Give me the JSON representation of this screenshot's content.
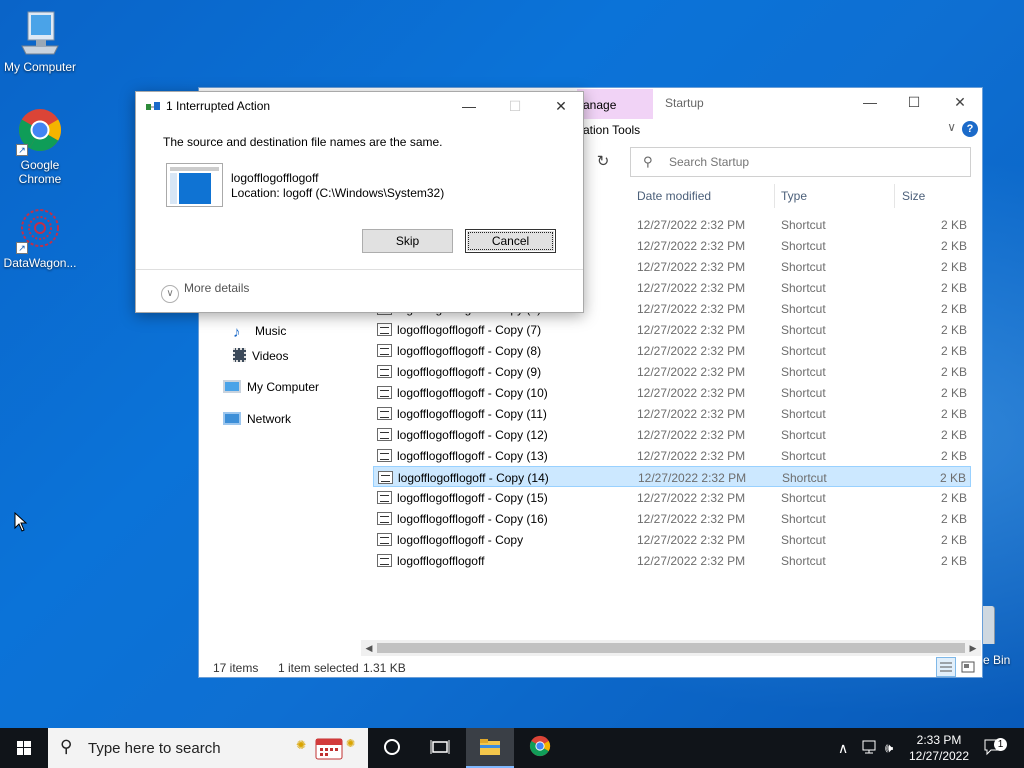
{
  "desktop": {
    "icons": [
      {
        "label": "My Computer"
      },
      {
        "label": "Google Chrome"
      },
      {
        "label": "DataWagon..."
      },
      {
        "label": "e Bin"
      }
    ]
  },
  "explorer": {
    "ribbon_tab_manage": "anage",
    "ribbon_tab_startup": "Startup",
    "ribbon_tools": "ation Tools",
    "search_placeholder": "Search Startup",
    "columns": {
      "date": "Date modified",
      "type": "Type",
      "size": "Size"
    },
    "nav": [
      {
        "label": "Music",
        "icon": "music-icon"
      },
      {
        "label": "Videos",
        "icon": "videos-icon"
      },
      {
        "label": "My Computer",
        "icon": "computer-icon"
      },
      {
        "label": "Network",
        "icon": "network-icon"
      }
    ],
    "files": [
      {
        "name": "",
        "date": "12/27/2022 2:32 PM",
        "type": "Shortcut",
        "size": "2 KB"
      },
      {
        "name": "",
        "date": "12/27/2022 2:32 PM",
        "type": "Shortcut",
        "size": "2 KB"
      },
      {
        "name": "",
        "date": "12/27/2022 2:32 PM",
        "type": "Shortcut",
        "size": "2 KB"
      },
      {
        "name": "",
        "date": "12/27/2022 2:32 PM",
        "type": "Shortcut",
        "size": "2 KB"
      },
      {
        "name": "logofflogofflogoff - Copy (6)",
        "date": "12/27/2022 2:32 PM",
        "type": "Shortcut",
        "size": "2 KB"
      },
      {
        "name": "logofflogofflogoff - Copy (7)",
        "date": "12/27/2022 2:32 PM",
        "type": "Shortcut",
        "size": "2 KB"
      },
      {
        "name": "logofflogofflogoff - Copy (8)",
        "date": "12/27/2022 2:32 PM",
        "type": "Shortcut",
        "size": "2 KB"
      },
      {
        "name": "logofflogofflogoff - Copy (9)",
        "date": "12/27/2022 2:32 PM",
        "type": "Shortcut",
        "size": "2 KB"
      },
      {
        "name": "logofflogofflogoff - Copy (10)",
        "date": "12/27/2022 2:32 PM",
        "type": "Shortcut",
        "size": "2 KB"
      },
      {
        "name": "logofflogofflogoff - Copy (11)",
        "date": "12/27/2022 2:32 PM",
        "type": "Shortcut",
        "size": "2 KB"
      },
      {
        "name": "logofflogofflogoff - Copy (12)",
        "date": "12/27/2022 2:32 PM",
        "type": "Shortcut",
        "size": "2 KB"
      },
      {
        "name": "logofflogofflogoff - Copy (13)",
        "date": "12/27/2022 2:32 PM",
        "type": "Shortcut",
        "size": "2 KB"
      },
      {
        "name": "logofflogofflogoff - Copy (14)",
        "date": "12/27/2022 2:32 PM",
        "type": "Shortcut",
        "size": "2 KB",
        "selected": true
      },
      {
        "name": "logofflogofflogoff - Copy (15)",
        "date": "12/27/2022 2:32 PM",
        "type": "Shortcut",
        "size": "2 KB"
      },
      {
        "name": "logofflogofflogoff - Copy (16)",
        "date": "12/27/2022 2:32 PM",
        "type": "Shortcut",
        "size": "2 KB"
      },
      {
        "name": "logofflogofflogoff - Copy",
        "date": "12/27/2022 2:32 PM",
        "type": "Shortcut",
        "size": "2 KB"
      },
      {
        "name": "logofflogofflogoff",
        "date": "12/27/2022 2:32 PM",
        "type": "Shortcut",
        "size": "2 KB"
      }
    ],
    "status": {
      "items": "17 items",
      "selected": "1 item selected",
      "size": "1.31 KB"
    }
  },
  "dialog": {
    "title": "1 Interrupted Action",
    "message": "The source and destination file names are the same.",
    "file_name": "logofflogofflogoff",
    "location": "Location: logoff (C:\\Windows\\System32)",
    "skip_label": "Skip",
    "cancel_label": "Cancel",
    "more_details": "More details"
  },
  "taskbar": {
    "search_placeholder": "Type here to search",
    "time": "2:33 PM",
    "date": "12/27/2022",
    "notification_count": "1"
  },
  "colors": {
    "selection": "#cce8ff",
    "accent": "#0f73d3",
    "taskbar": "#101419",
    "manage_tab": "#f1d3f6"
  }
}
